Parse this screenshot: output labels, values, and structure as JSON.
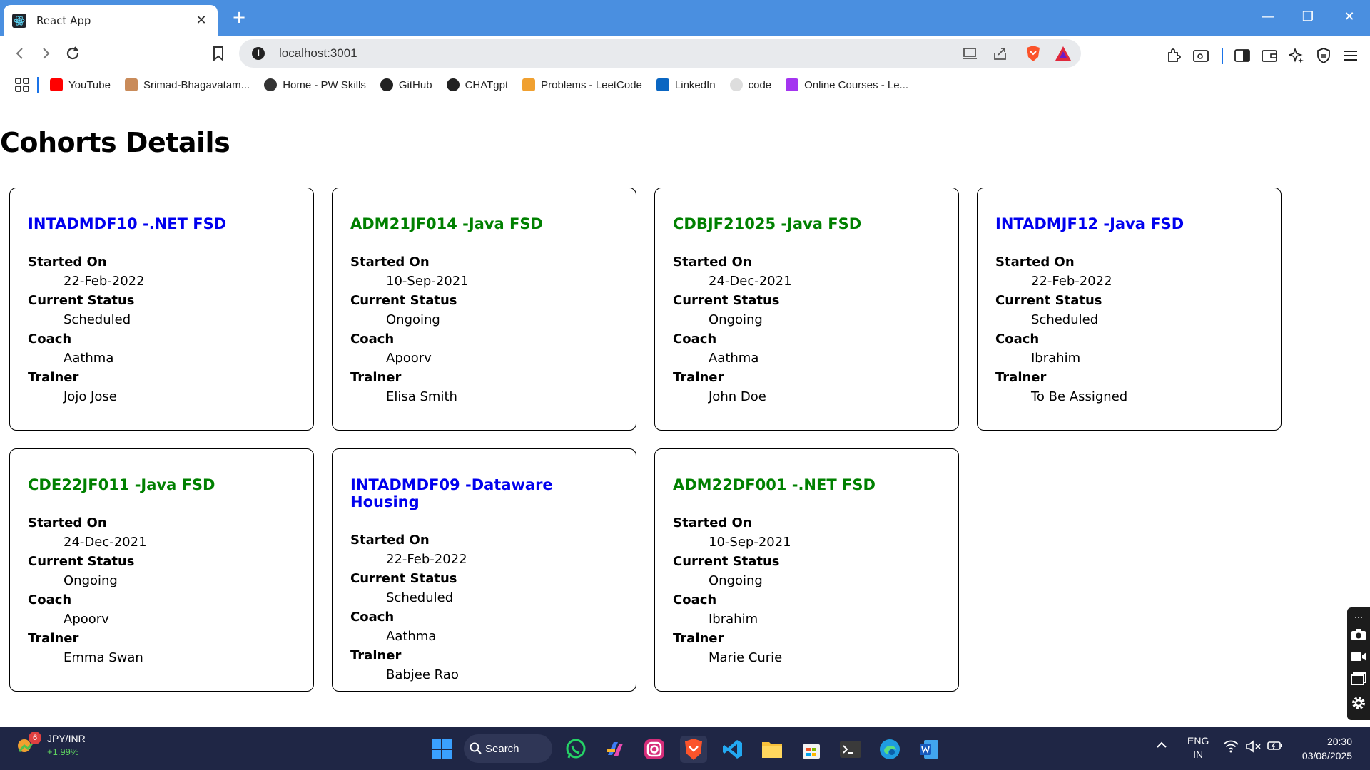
{
  "browser": {
    "tab_title": "React App",
    "new_tab_label": "+",
    "url": "localhost:3001",
    "minimize": "—",
    "restore": "❐",
    "close": "✕"
  },
  "bookmarks": [
    {
      "label": "YouTube",
      "icon": "youtube-icon",
      "color": "#ff0000"
    },
    {
      "label": "Srimad-Bhagavatam...",
      "icon": "avatar-icon",
      "color": "#c98b5a"
    },
    {
      "label": "Home - PW Skills",
      "icon": "pw-icon",
      "color": "#333333"
    },
    {
      "label": "GitHub",
      "icon": "github-icon",
      "color": "#222222"
    },
    {
      "label": "CHATgpt",
      "icon": "openai-icon",
      "color": "#222222"
    },
    {
      "label": "Problems - LeetCode",
      "icon": "leetcode-icon",
      "color": "#f0a030"
    },
    {
      "label": "LinkedIn",
      "icon": "linkedin-icon",
      "color": "#0a66c2"
    },
    {
      "label": "code",
      "icon": "code-icon",
      "color": "#dddddd"
    },
    {
      "label": "Online Courses - Le...",
      "icon": "udemy-icon",
      "color": "#a435f0"
    }
  ],
  "page": {
    "title": "Cohorts Details"
  },
  "labels": {
    "started_on": "Started On",
    "current_status": "Current Status",
    "coach": "Coach",
    "trainer": "Trainer"
  },
  "cohorts": [
    {
      "name": "INTADMDF10 -.NET FSD",
      "started": "22-Feb-2022",
      "status": "Scheduled",
      "coach": "Aathma",
      "trainer": "Jojo Jose",
      "color": "blue"
    },
    {
      "name": "ADM21JF014 -Java FSD",
      "started": "10-Sep-2021",
      "status": "Ongoing",
      "coach": "Apoorv",
      "trainer": "Elisa Smith",
      "color": "green"
    },
    {
      "name": "CDBJF21025 -Java FSD",
      "started": "24-Dec-2021",
      "status": "Ongoing",
      "coach": "Aathma",
      "trainer": "John Doe",
      "color": "green"
    },
    {
      "name": "INTADMJF12 -Java FSD",
      "started": "22-Feb-2022",
      "status": "Scheduled",
      "coach": "Ibrahim",
      "trainer": "To Be Assigned",
      "color": "blue"
    },
    {
      "name": "CDE22JF011 -Java FSD",
      "started": "24-Dec-2021",
      "status": "Ongoing",
      "coach": "Apoorv",
      "trainer": "Emma Swan",
      "color": "green"
    },
    {
      "name": "INTADMDF09 -Dataware Housing",
      "started": "22-Feb-2022",
      "status": "Scheduled",
      "coach": "Aathma",
      "trainer": "Babjee Rao",
      "color": "blue"
    },
    {
      "name": "ADM22DF001 -.NET FSD",
      "started": "10-Sep-2021",
      "status": "Ongoing",
      "coach": "Ibrahim",
      "trainer": "Marie Curie",
      "color": "green"
    }
  ],
  "taskbar": {
    "stock_badge": "6",
    "stock_name": "JPY/INR",
    "stock_change": "+1.99%",
    "search_label": "Search",
    "lang_1": "ENG",
    "lang_2": "IN",
    "time": "20:30",
    "date": "03/08/2025"
  },
  "colors": {
    "tab_strip": "#4a8fe0",
    "taskbar": "#1f2645",
    "link_blue": "#0000ee",
    "ongoing_green": "#008000"
  }
}
